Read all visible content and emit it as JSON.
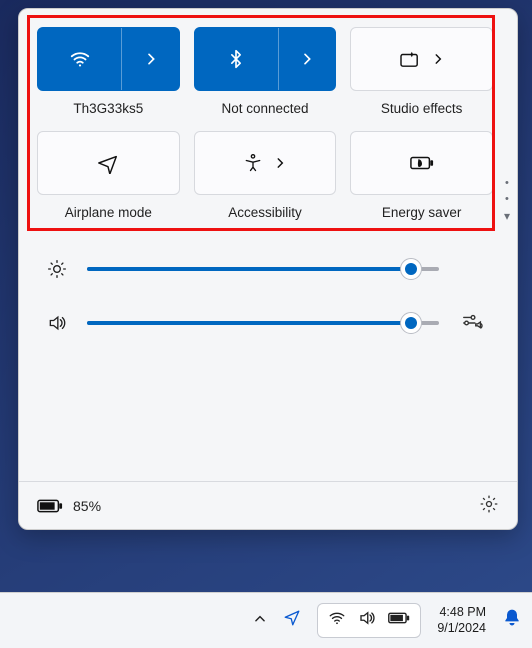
{
  "tiles": {
    "wifi": {
      "label": "Th3G33ks5"
    },
    "bluetooth": {
      "label": "Not connected"
    },
    "studio": {
      "label": "Studio effects"
    },
    "airplane": {
      "label": "Airplane mode"
    },
    "accessibility": {
      "label": "Accessibility"
    },
    "energy": {
      "label": "Energy saver"
    }
  },
  "sliders": {
    "brightness": {
      "percent": 92
    },
    "volume": {
      "percent": 92
    }
  },
  "battery": {
    "text": "85%"
  },
  "taskbar": {
    "time": "4:48 PM",
    "date": "9/1/2024"
  }
}
